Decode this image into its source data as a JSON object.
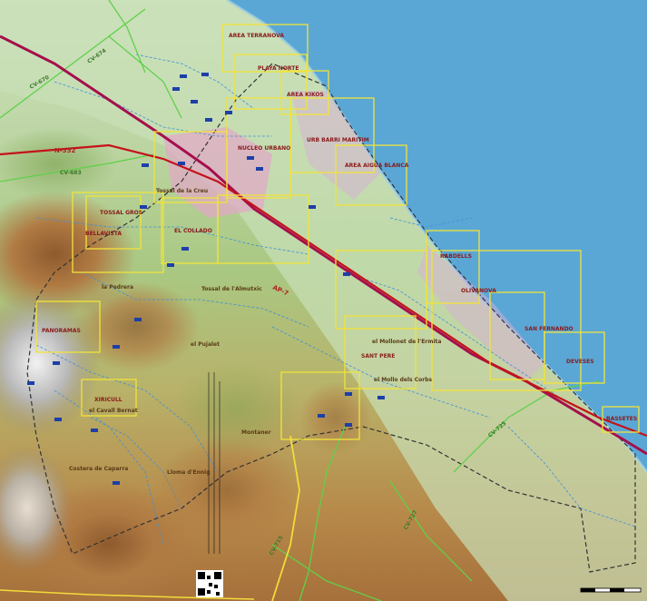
{
  "map": {
    "zones": [
      "AREA TERRANOVA",
      "PLAYA NORTE",
      "AREA KIKOS",
      "NUCLEO URBANO",
      "URB BARRI MARITIM",
      "AREA AIGUA BLANCA",
      "TOSSAL GROS",
      "BELLAVISTA",
      "EL COLLADO",
      "RABDELLS",
      "OLIVANOVA",
      "SAN FERNANDO",
      "DEVESES",
      "PANORAMAS",
      "XIRICULL",
      "SANT PERE",
      "BASSETES"
    ],
    "places": [
      "Tossal de la Creu",
      "la Pedrera",
      "Tossal de l'Almutxic",
      "el Pujalet",
      "el Mollonet de l'Ermita",
      "el Mollo dels Corbs",
      "el Cavall Bernat",
      "Montaner",
      "Costera de Caparra",
      "Lloma d'Ennig"
    ],
    "roads": [
      "CV-670",
      "CV-674",
      "CV-683",
      "AP-7",
      "N-332",
      "CV-715",
      "CV-727",
      "CV-725"
    ],
    "colors": {
      "sea": "#5aa7d6",
      "coast_plain": "#c3dcb4",
      "motorway": "#a50f4c",
      "zone_outline": "#f2e33a",
      "zone_label": "#8a1a1a",
      "municipal_border": "#333333"
    },
    "qr_icon": "qr-code-icon",
    "scale_bar_icon": "scale-bar-icon"
  }
}
